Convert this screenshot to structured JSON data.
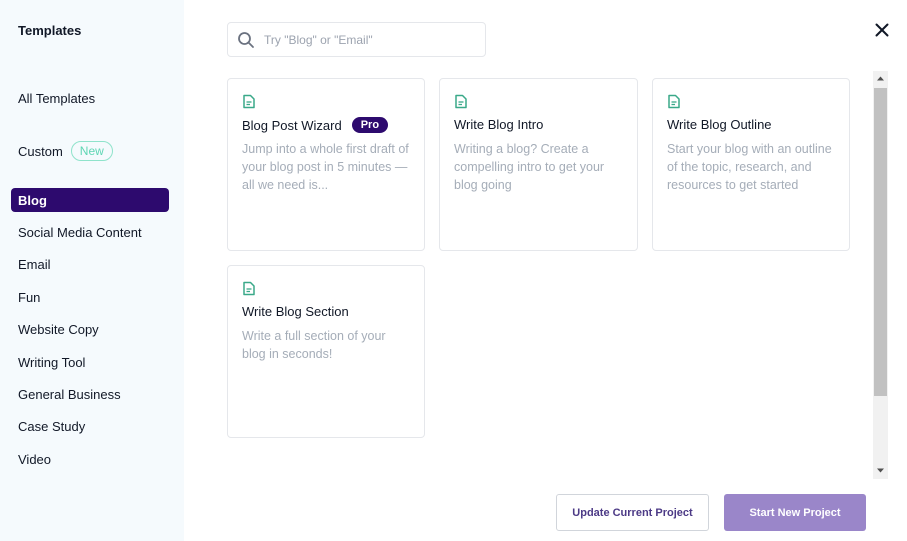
{
  "sidebar": {
    "title": "Templates",
    "items": [
      {
        "label": "All Templates"
      },
      {
        "label": "Custom",
        "badge": "New"
      },
      {
        "label": "Blog",
        "active": true
      },
      {
        "label": "Social Media Content"
      },
      {
        "label": "Email"
      },
      {
        "label": "Fun"
      },
      {
        "label": "Website Copy"
      },
      {
        "label": "Writing Tool"
      },
      {
        "label": "General Business"
      },
      {
        "label": "Case Study"
      },
      {
        "label": "Video"
      }
    ]
  },
  "search": {
    "placeholder": "Try \"Blog\" or \"Email\"",
    "value": ""
  },
  "cards": [
    {
      "title": "Blog Post Wizard",
      "badge": "Pro",
      "description": "Jump into a whole first draft of your blog post in 5 minutes — all we need is...",
      "icon": "document-icon"
    },
    {
      "title": "Write Blog Intro",
      "description": "Writing a blog? Create a compelling intro to get your blog going",
      "icon": "document-icon"
    },
    {
      "title": "Write Blog Outline",
      "description": "Start your blog with an outline of the topic, research, and resources to get started",
      "icon": "document-icon"
    },
    {
      "title": "Write Blog Section",
      "description": "Write a full section of your blog in seconds!",
      "icon": "document-icon"
    }
  ],
  "footer": {
    "update_label": "Update Current Project",
    "start_label": "Start New Project"
  },
  "colors": {
    "accent": "#2d0a6e",
    "icon_green": "#3aa989",
    "new_badge": "#5fd6b4",
    "start_button": "#9a86c9"
  }
}
